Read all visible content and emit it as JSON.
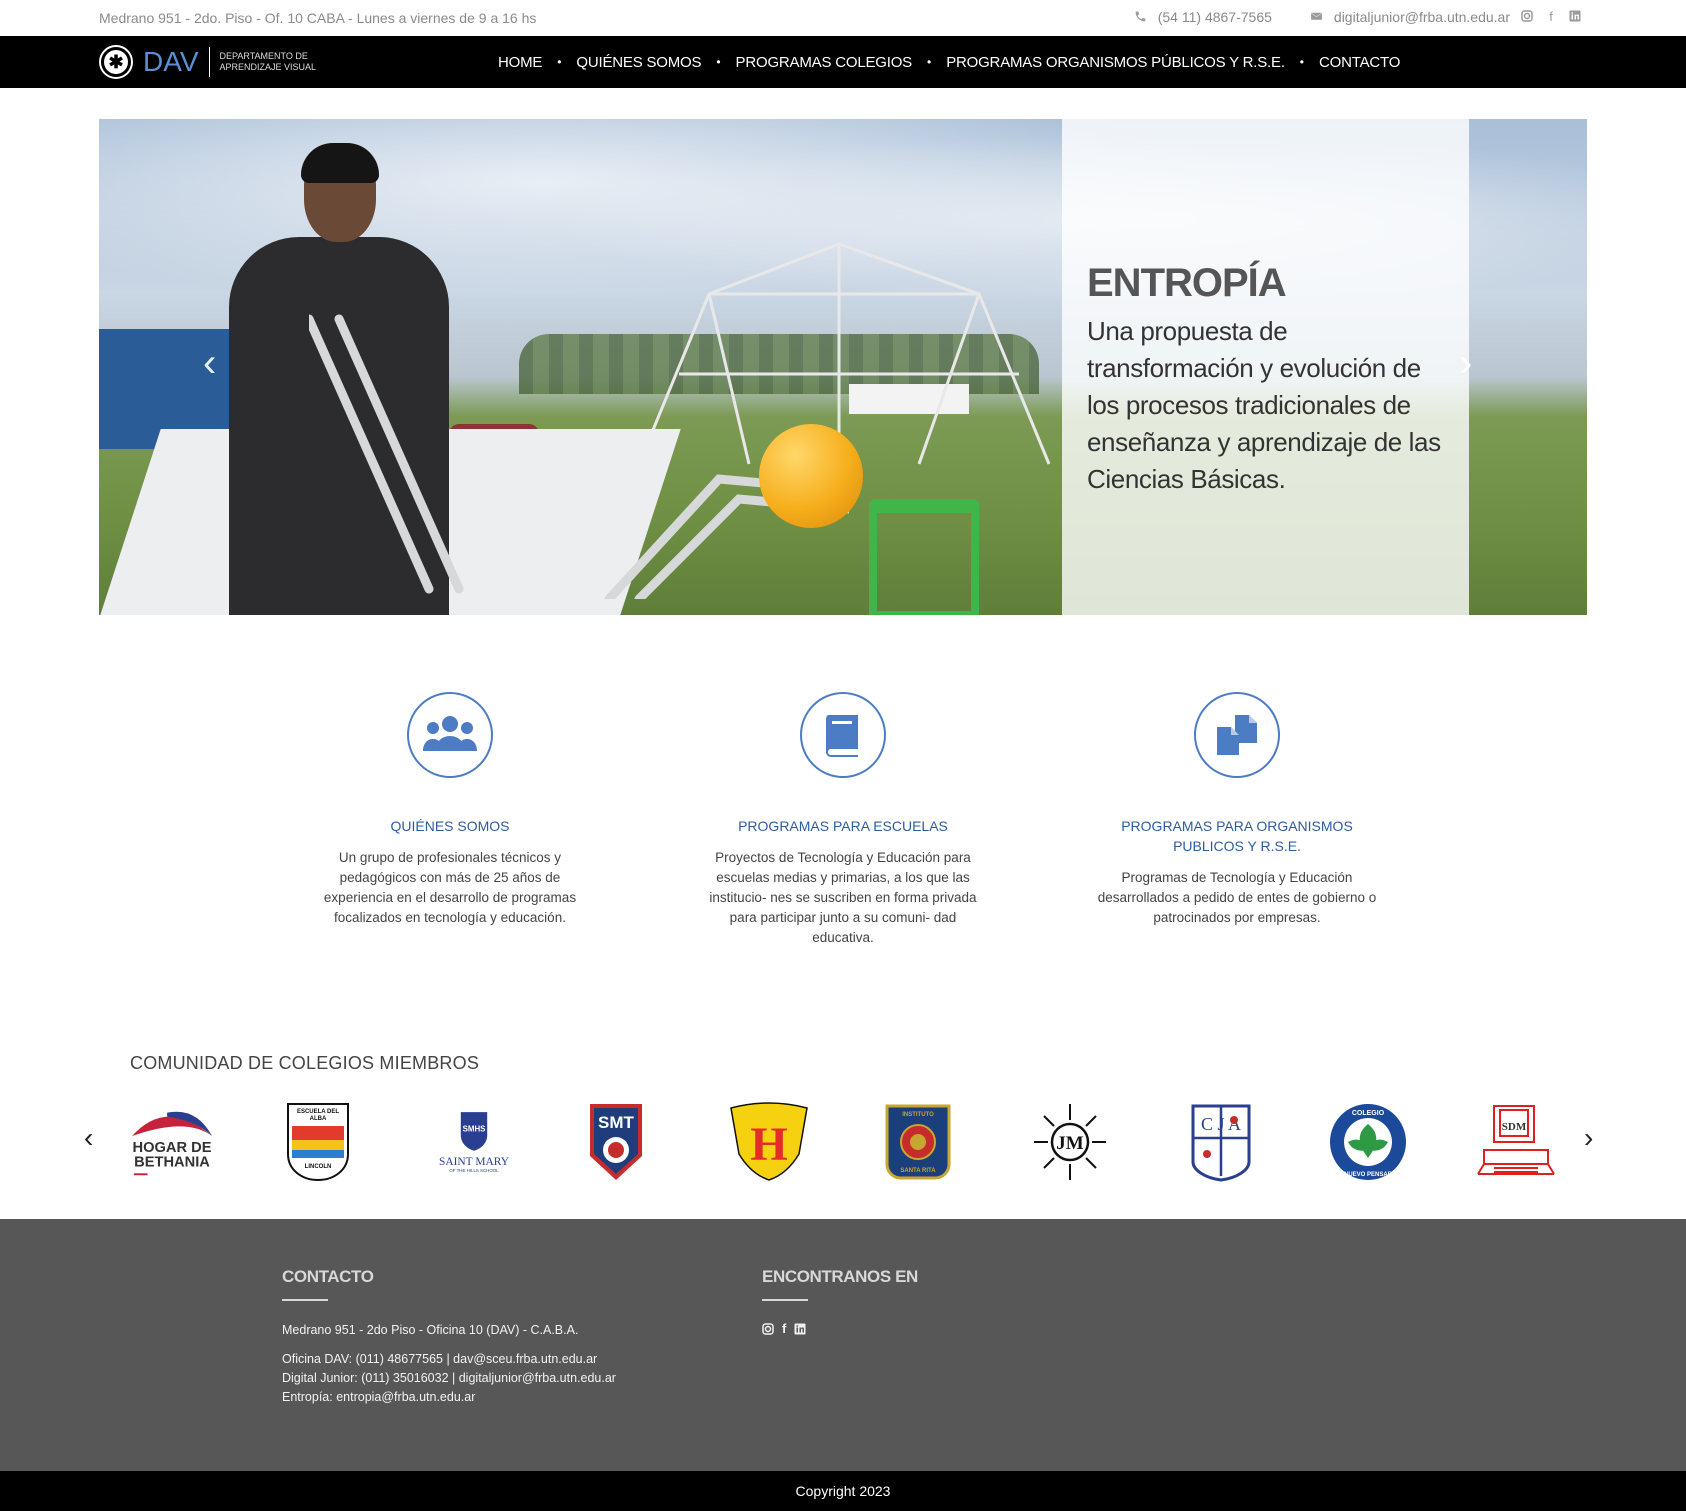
{
  "topbar": {
    "address": "Medrano 951 - 2do. Piso - Of. 10 CABA - Lunes a viernes de 9 a 16 hs",
    "phone": "(54 11) 4867-7565",
    "email": "digitaljunior@frba.utn.edu.ar",
    "icons": [
      "phone-icon",
      "mail-icon",
      "instagram-icon",
      "facebook-icon",
      "linkedin-icon"
    ]
  },
  "brand": {
    "name": "DAV",
    "subtitle_line1": "Departamento de",
    "subtitle_line2": "Aprendizaje Visual",
    "accent": "#5b8fd4"
  },
  "nav": {
    "items": [
      {
        "label": "HOME"
      },
      {
        "label": "QUIÉNES SOMOS"
      },
      {
        "label": "PROGRAMAS COLEGIOS"
      },
      {
        "label": "PROGRAMAS ORGANISMOS PÚBLICOS Y R.S.E."
      },
      {
        "label": "CONTACTO"
      }
    ]
  },
  "hero": {
    "title": "ENTROPÍA",
    "text": "Una propuesta de transformación y evolución de los procesos tradicionales de enseñanza y aprendizaje de las Ciencias Básicas.",
    "prev_arrow": "‹",
    "next_arrow": "›"
  },
  "features": [
    {
      "icon": "users-icon",
      "title": "QUIÉNES SOMOS",
      "description": "Un grupo de profesionales técnicos y pedagógicos con más de 25 años de experiencia en el desarrollo de programas focalizados en tecnología y educación."
    },
    {
      "icon": "book-icon",
      "title": "PROGRAMAS PARA ESCUELAS",
      "description": "Proyectos de Tecnología y Educación para escuelas medias y primarias, a los que las institucio- nes se suscriben en forma privada para participar junto a su comuni- dad educativa."
    },
    {
      "icon": "copy-icon",
      "title": "PROGRAMAS PARA ORGANISMOS PUBLICOS Y R.S.E.",
      "description": "Programas de Tecnología y Educación desarrollados a pedido de entes de gobierno o patrocinados por empresas."
    }
  ],
  "community": {
    "title": "COMUNIDAD DE COLEGIOS MIEMBROS",
    "prev_arrow": "‹",
    "next_arrow": "›",
    "logos": [
      {
        "name": "hogar-de-bethania-logo",
        "line1": "HOGAR DE",
        "line2": "BETHANIA"
      },
      {
        "name": "escuela-del-alba-logo",
        "line1": "ESCUELA DEL",
        "line2": "ALBA",
        "line3": "LINCOLN"
      },
      {
        "name": "saint-mary-logo",
        "line1": "SAINT MARY",
        "line2": "OF THE HILLS SCHOOL",
        "mark": "SMHS"
      },
      {
        "name": "smt-logo",
        "mark": "SMT"
      },
      {
        "name": "h-shield-logo",
        "mark": "H"
      },
      {
        "name": "instituto-santa-rita-logo",
        "line1": "INSTITUTO",
        "line2": "SANTA RITA"
      },
      {
        "name": "jm-logo",
        "mark": "JM"
      },
      {
        "name": "cja-logo",
        "mark": "C J A"
      },
      {
        "name": "colegio-nuevo-pensar-logo",
        "line1": "COLEGIO",
        "line2": "NUEVO PENSAR"
      },
      {
        "name": "sdm-logo",
        "mark": "SDM"
      }
    ]
  },
  "footer": {
    "contact_title": "CONTACTO",
    "address": "Medrano 951 - 2do Piso - Oficina 10 (DAV) - C.A.B.A.",
    "line_dav": "Oficina DAV: (011) 48677565 | dav@sceu.frba.utn.edu.ar",
    "line_digital": "Digital Junior: (011) 35016032 | digitaljunior@frba.utn.edu.ar",
    "line_entropia": "Entropía: entropia@frba.utn.edu.ar",
    "social_title": "ENCONTRANOS EN",
    "background": "#575757"
  },
  "copyright": "Copyright 2023"
}
